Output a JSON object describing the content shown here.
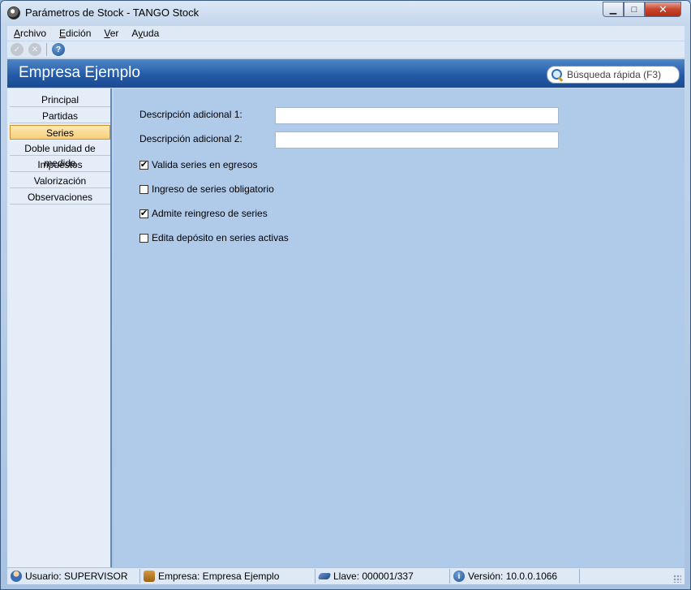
{
  "window": {
    "title": "Parámetros de Stock - TANGO Stock",
    "minimize": "▁",
    "maximize": "□",
    "close": "✕"
  },
  "menu": {
    "items": [
      {
        "label": "Archivo",
        "accel": "A",
        "rest": "rchivo"
      },
      {
        "label": "Edición",
        "accel": "E",
        "rest": "dición"
      },
      {
        "label": "Ver",
        "accel": "V",
        "rest": "er"
      },
      {
        "label": "Ayuda",
        "accel": "y",
        "pre": "A",
        "rest": "uda"
      }
    ]
  },
  "toolbar": {
    "accept_icon": "check-icon",
    "cancel_icon": "cancel-icon",
    "help_icon": "help-icon",
    "accept_glyph": "✓",
    "cancel_glyph": "✕",
    "help_glyph": "?"
  },
  "header": {
    "title": "Empresa Ejemplo",
    "search_placeholder": "Búsqueda rápida (F3)"
  },
  "nav": {
    "items": [
      "Principal",
      "Partidas",
      "Series",
      "Doble unidad de medida",
      "Impuestos",
      "Valorización",
      "Observaciones"
    ],
    "active": "Series"
  },
  "form": {
    "desc1_label": "Descripción adicional 1:",
    "desc1_value": "",
    "desc2_label": "Descripción adicional 2:",
    "desc2_value": "",
    "checkboxes": [
      {
        "label": "Valida series en egresos",
        "checked": true
      },
      {
        "label": "Ingreso de series obligatorio",
        "checked": false
      },
      {
        "label": "Admite reingreso de series",
        "checked": true
      },
      {
        "label": "Edita depósito en series activas",
        "checked": false
      }
    ]
  },
  "status": {
    "user": "Usuario: SUPERVISOR",
    "company": "Empresa: Empresa Ejemplo",
    "key": "Llave: 000001/337",
    "version": "Versión: 10.0.0.1066",
    "info_glyph": "i"
  },
  "colors": {
    "header_blue": "#245ca8",
    "active_nav": "#f8cf7a",
    "content_bg": "#b0caea"
  }
}
